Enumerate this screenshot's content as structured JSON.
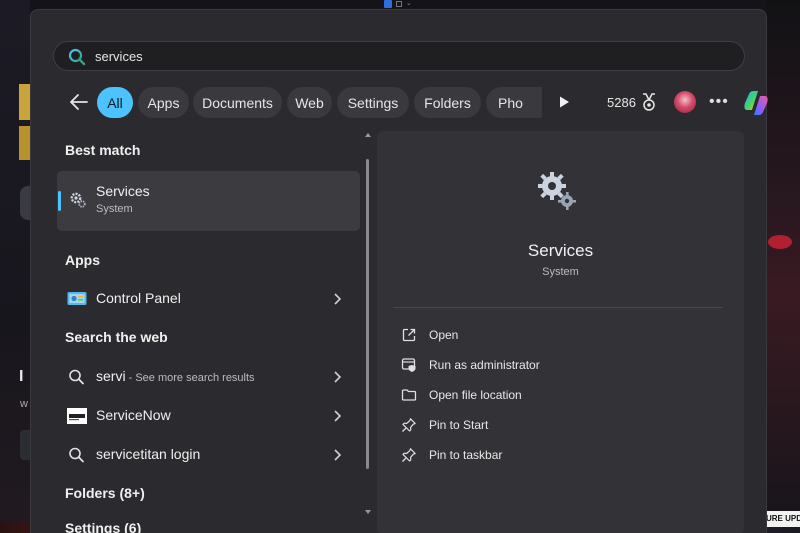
{
  "search": {
    "query": "services"
  },
  "filters": {
    "items": [
      "All",
      "Apps",
      "Documents",
      "Web",
      "Settings",
      "Folders",
      "Pho"
    ],
    "active": "All",
    "points": "5286"
  },
  "results": {
    "best_match_heading": "Best match",
    "best_match": {
      "title": "Services",
      "subtitle": "System",
      "icon": "gear-icon"
    },
    "apps_heading": "Apps",
    "apps": [
      {
        "label": "Control Panel",
        "icon": "control-panel-icon"
      }
    ],
    "web_heading": "Search the web",
    "web": [
      {
        "label": "servi",
        "suffix": " - See more search results",
        "icon": "search-icon"
      },
      {
        "label": "ServiceNow",
        "icon": "servicenow-icon"
      },
      {
        "label": "servicetitan login",
        "icon": "search-icon"
      }
    ],
    "folders_heading": "Folders (8+)",
    "settings_heading": "Settings (6)"
  },
  "detail": {
    "title": "Services",
    "subtitle": "System",
    "actions": [
      {
        "label": "Open",
        "icon": "open-external-icon"
      },
      {
        "label": "Run as administrator",
        "icon": "shield-window-icon"
      },
      {
        "label": "Open file location",
        "icon": "folder-icon"
      },
      {
        "label": "Pin to Start",
        "icon": "pin-icon"
      },
      {
        "label": "Pin to taskbar",
        "icon": "pin-icon"
      }
    ]
  },
  "background": {
    "letter": "I",
    "small_text": "w",
    "badge": "URE UPDAT"
  },
  "colors": {
    "accent": "#4cc2ff",
    "panel": "#2b2a2e",
    "detail_panel": "#333237"
  }
}
